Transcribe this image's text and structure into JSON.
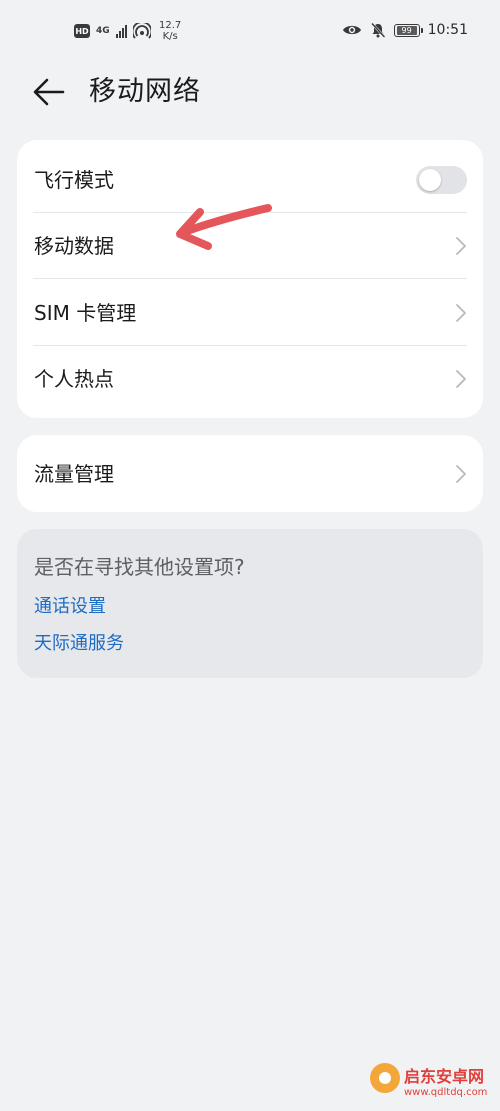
{
  "status_bar": {
    "hd": "HD",
    "network": "4G",
    "speed_value": "12.7",
    "speed_unit": "K/s",
    "battery": "99",
    "time": "10:51"
  },
  "header": {
    "title": "移动网络"
  },
  "main_card": {
    "rows": [
      {
        "label": "飞行模式",
        "type": "toggle",
        "checked": false
      },
      {
        "label": "移动数据",
        "type": "chevron"
      },
      {
        "label": "SIM 卡管理",
        "type": "chevron"
      },
      {
        "label": "个人热点",
        "type": "chevron"
      }
    ]
  },
  "traffic_card": {
    "label": "流量管理"
  },
  "suggestions": {
    "question": "是否在寻找其他设置项?",
    "links": [
      "通话设置",
      "天际通服务"
    ]
  },
  "watermark": {
    "name": "启东安卓网",
    "url": "www.qdltdq.com"
  },
  "colors": {
    "background": "#f1f2f4",
    "card": "#ffffff",
    "link": "#1f6cc4",
    "annotation_arrow": "#e4565a"
  },
  "icons": {
    "back": "arrow-left-icon",
    "chevron": "chevron-right-icon",
    "eye": "eye-icon",
    "mute": "bell-slash-icon"
  }
}
